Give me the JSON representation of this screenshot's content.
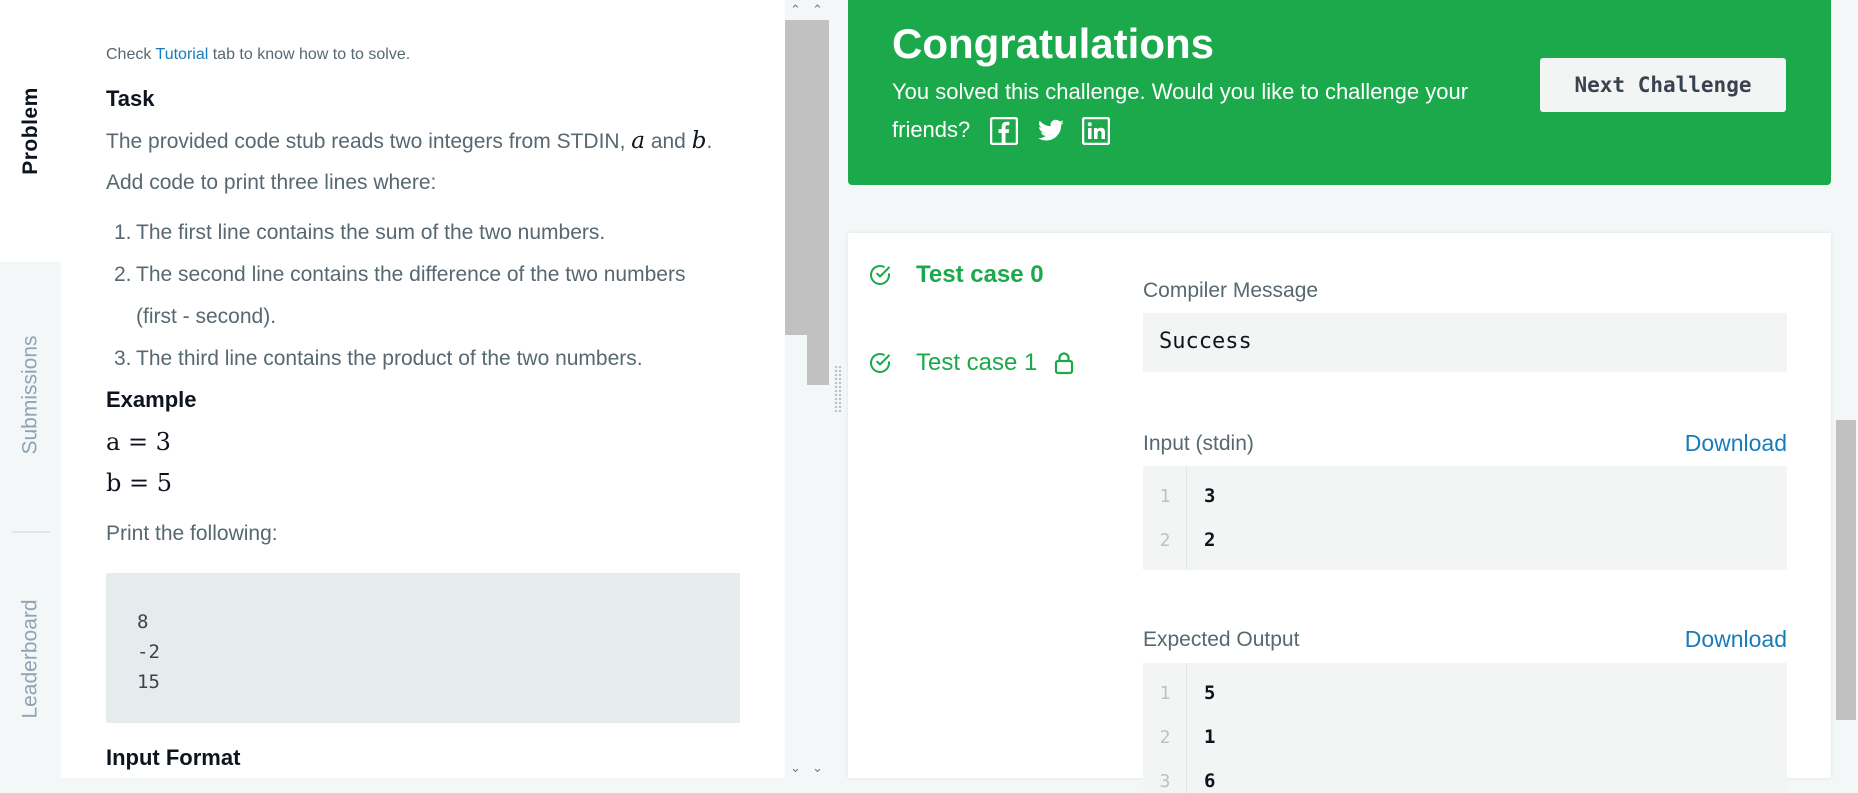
{
  "tabs": {
    "problem": "Problem",
    "submissions": "Submissions",
    "leaderboard": "Leaderboard"
  },
  "problem": {
    "hint_prefix": "Check",
    "hint_link": "Tutorial",
    "hint_suffix": "tab to know how to to solve.",
    "task_heading": "Task",
    "task_text_1": "The provided code stub reads two integers from STDIN,",
    "var_a": "a",
    "and_word": "and",
    "var_b": "b",
    "task_text_2": "Add code to print three lines where:",
    "list": [
      {
        "num": "1.",
        "text": "The first line contains the sum of the two numbers."
      },
      {
        "num": "2.",
        "text": "The second line contains the difference of the two numbers"
      },
      {
        "num": "",
        "text": "(first - second)."
      },
      {
        "num": "3.",
        "text": "The third line contains the product of the two numbers."
      }
    ],
    "example_heading": "Example",
    "example_a": "a = 3",
    "example_b": "b = 5",
    "print_following": "Print the following:",
    "code_lines": [
      "8",
      "-2",
      "15"
    ],
    "input_format_heading": "Input Format"
  },
  "banner": {
    "title": "Congratulations",
    "text": "You solved this challenge. Would you like to challenge your friends?",
    "social_icons": [
      "facebook-icon",
      "twitter-icon",
      "linkedin-icon"
    ],
    "next_button": "Next Challenge",
    "color": "#1ba94c"
  },
  "results": {
    "test_cases": [
      {
        "label": "Test case 0",
        "status": "passed",
        "selected": true
      },
      {
        "label": "Test case 1",
        "status": "passed",
        "locked": true
      }
    ],
    "compiler_message_label": "Compiler Message",
    "compiler_message": "Success",
    "input_label": "Input (stdin)",
    "input_download": "Download",
    "input_lines": [
      {
        "ln": "1",
        "val": "3"
      },
      {
        "ln": "2",
        "val": "2"
      }
    ],
    "expected_label": "Expected Output",
    "expected_download": "Download",
    "expected_lines": [
      {
        "ln": "1",
        "val": "5"
      },
      {
        "ln": "2",
        "val": "1"
      },
      {
        "ln": "3",
        "val": "6"
      }
    ]
  }
}
